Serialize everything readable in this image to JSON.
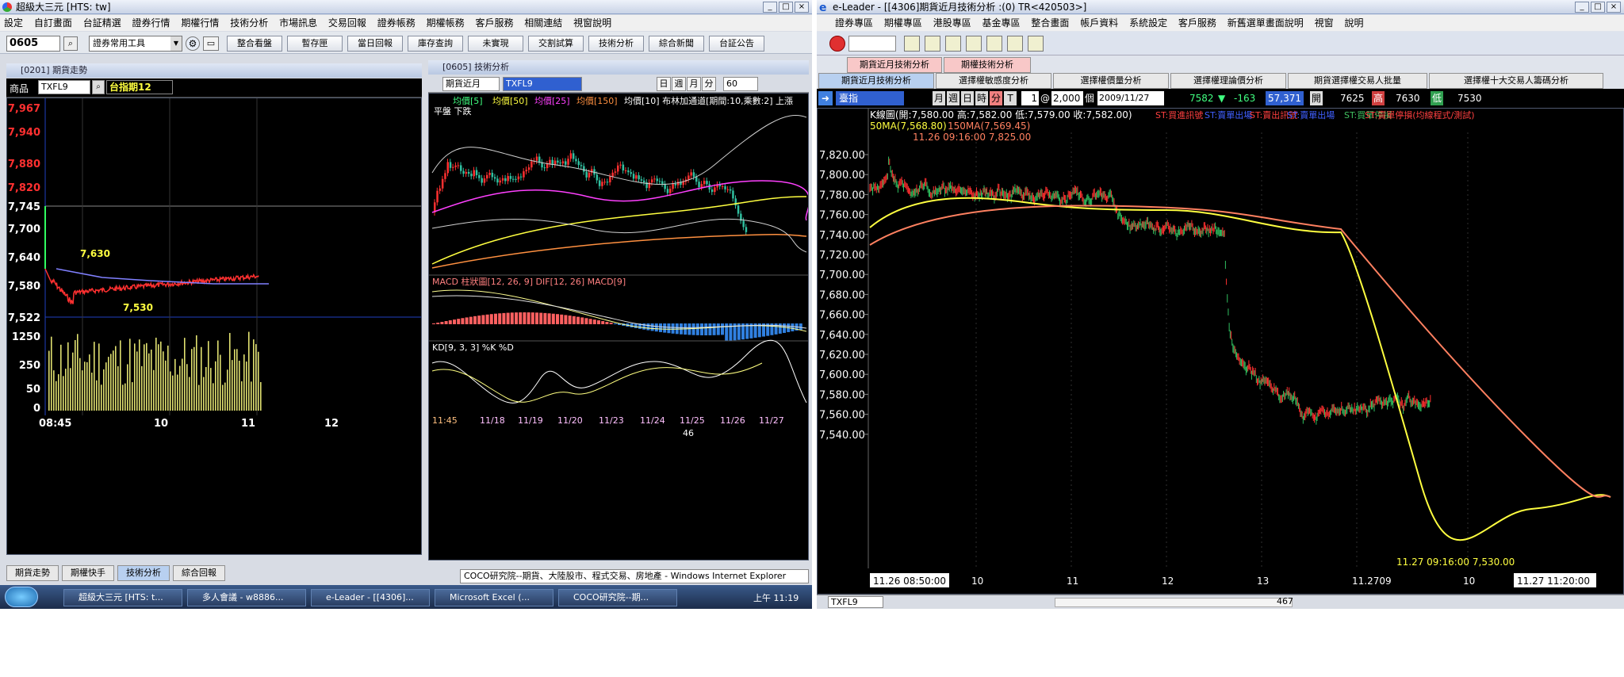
{
  "left_window": {
    "title": "超級大三元 [HTS: tw]",
    "menu": [
      "設定",
      "自訂畫面",
      "台証精選",
      "證券行情",
      "期權行情",
      "技術分析",
      "市場訊息",
      "交易回報",
      "證券帳務",
      "期權帳務",
      "客戶服務",
      "相關連結",
      "視窗說明"
    ],
    "code_input": "0605",
    "tool_select": "證券常用工具",
    "buttons": [
      "整合看盤",
      "暫存匣",
      "當日回報",
      "庫存查詢",
      "未實現",
      "交割試算",
      "技術分析",
      "綜合新聞",
      "台証公告"
    ],
    "tick_panel": {
      "title": "[0201] 期貨走勢",
      "product_label": "商品",
      "product": "TXFL9",
      "product_name": "台指期12",
      "price_labels": [
        "7,967",
        "7,940",
        "7,880",
        "7,820",
        "7,745",
        "7,700",
        "7,640",
        "7,580",
        "7,522"
      ],
      "annot_high": "7,630",
      "annot_low": "7,530",
      "vol_labels": [
        "1250",
        "250",
        "50",
        "0"
      ],
      "time_labels": [
        "08:45",
        "10",
        "11",
        "12"
      ]
    },
    "ta_panel": {
      "title": "[0605] 技術分析",
      "period": "期貨近月",
      "symbol": "TXFL9",
      "period_buttons": [
        "日",
        "週",
        "月",
        "分"
      ],
      "interval": "60",
      "ma_legend": {
        "ma5": "均價[5]",
        "ma50": "均價[50]",
        "ma25": "均價[25]",
        "ma150": "均價[150]",
        "ma10": "均價[10] 布林加通道[期間:10,乘數:2] 上漲"
      },
      "sub_legend": "平盤  下跌",
      "macd_legend": "MACD 柱狀圖[12, 26, 9]  DIF[12, 26]  MACD[9]",
      "kd_legend": "KD[9, 3, 3]  %K  %D",
      "date_labels": [
        "11:45",
        "11/18",
        "11/19",
        "11/20",
        "11/23",
        "11/24",
        "11/25",
        "11/26",
        "11/27"
      ],
      "footer_count": "46"
    },
    "bottom_tabs": [
      "期貨走勢",
      "期權快手",
      "技術分析",
      "綜合回報"
    ],
    "ie_tooltip": "COCO研究院--期貨、大陸股市、程式交易、房地產 - Windows Internet Explorer",
    "taskbar": {
      "tasks": [
        "超級大三元 [HTS: t...",
        "多人會議 - w8886...",
        "e-Leader - [[4306]...",
        "Microsoft Excel (...",
        "COCO研究院--期..."
      ],
      "clock": "上午 11:19"
    }
  },
  "right_window": {
    "title": "e-Leader - [[4306]期貨近月技術分析 :(0) TR<420503>]",
    "menu": [
      "證券專區",
      "期權專區",
      "港股專區",
      "基金專區",
      "整合畫面",
      "帳戶資料",
      "系統設定",
      "客戶服務",
      "新舊選單畫面說明",
      "視窗",
      "說明"
    ],
    "tabs_top": [
      "期貨近月技術分析",
      "期權技術分析"
    ],
    "tabs_main": [
      "期貨近月技術分析",
      "選擇權敏感度分析",
      "選擇權價量分析",
      "選擇權理論價分析",
      "期貨選擇權交易人批量",
      "選擇權十大交易人籌碼分析"
    ],
    "controls": {
      "symbol_select": "臺指",
      "period_buttons": [
        "月",
        "週",
        "日",
        "時",
        "分",
        "T"
      ],
      "count": "1",
      "at": "@",
      "bars": "2,000",
      "bars_unit": "個",
      "date": "2009/11/27",
      "last": "7582",
      "change": "-163",
      "volume": "57,371",
      "open_label": "開",
      "open": "7625",
      "high_label": "高",
      "high": "7630",
      "low_label": "低",
      "low": "7530"
    },
    "kline_header": "K線圖(開:7,580.00 高:7,582.00 低:7,579.00 收:7,582.00)",
    "strategies": [
      {
        "text": "ST:買進訊號",
        "color": "#ff4040"
      },
      {
        "text": "ST:賣單出場",
        "color": "#4060ff"
      },
      {
        "text": "ST:賣出訊號",
        "color": "#ff4040"
      },
      {
        "text": "ST:賣單出場",
        "color": "#4060ff"
      },
      {
        "text": "ST:買單停損",
        "color": "#40c060"
      },
      {
        "text": "ST:賣單停損(均線程式/測試)",
        "color": "#ff4040"
      }
    ],
    "ma50_legend": "50MA(7,568.80)",
    "ma150_legend": "150MA(7,569.45)",
    "high_annot": "11.26 09:16:00  7,825.00",
    "low_annot": "11.27 09:16:00  7,530.00",
    "price_ticks": [
      "7,820.00",
      "7,800.00",
      "7,780.00",
      "7,760.00",
      "7,740.00",
      "7,720.00",
      "7,700.00",
      "7,680.00",
      "7,660.00",
      "7,640.00",
      "7,620.00",
      "7,600.00",
      "7,580.00",
      "7,560.00",
      "7,540.00"
    ],
    "time_start": "11.26 08:50:00",
    "time_labels": [
      "10",
      "11",
      "12",
      "13",
      "11.2709",
      "10"
    ],
    "time_end": "11.27 11:20:00",
    "bottom_symbol": "TXFL9",
    "bottom_count": "467"
  },
  "colors": {
    "ma50": "#ffff40",
    "ma150": "#ff8060",
    "up": "#ff3030",
    "down": "#30c0a0"
  }
}
